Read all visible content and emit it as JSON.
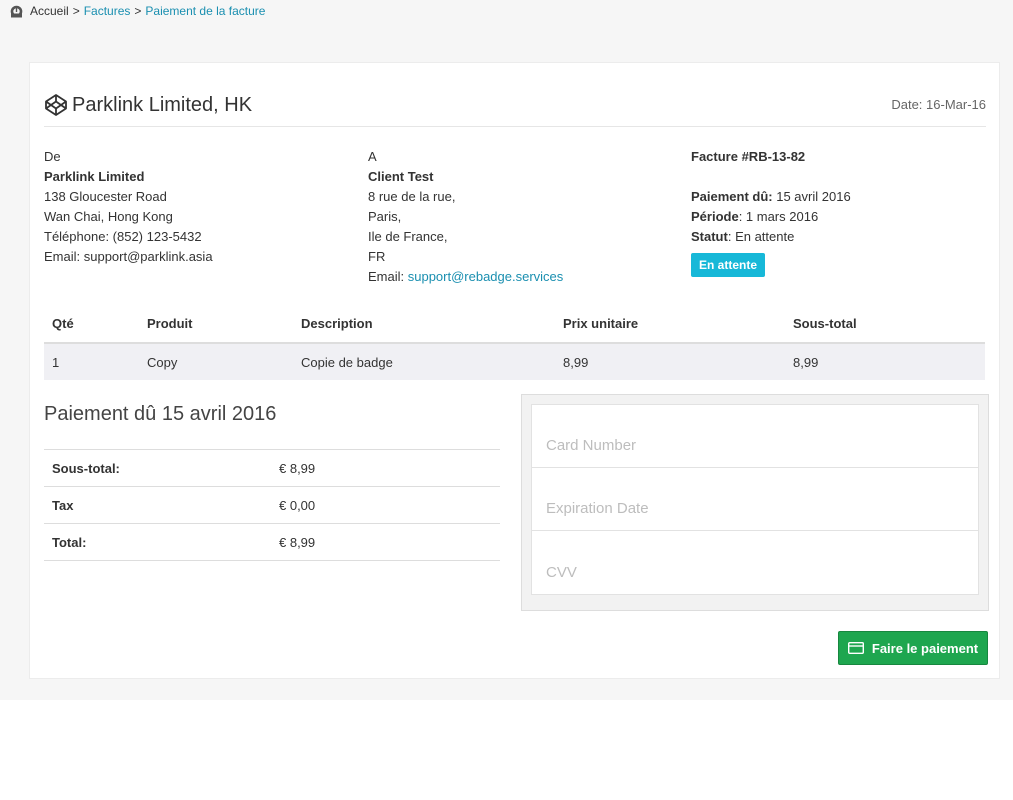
{
  "breadcrumb": {
    "home": "Accueil",
    "sep1": ">",
    "invoices": "Factures",
    "sep2": ">",
    "current": "Paiement de la facture"
  },
  "header": {
    "company_title": "Parklink Limited, HK",
    "date": "Date: 16-Mar-16"
  },
  "from": {
    "label": "De",
    "name": "Parklink Limited",
    "street": "138 Gloucester Road",
    "city": "Wan Chai, Hong Kong",
    "phone": "Téléphone: (852) 123-5432",
    "email": "Email: support@parklink.asia"
  },
  "to": {
    "label": "A",
    "name": "Client Test",
    "street": "8 rue de la rue,",
    "city": "Paris,",
    "region": "Ile de France,",
    "country": "FR",
    "email_label": "Email: ",
    "email": "support@rebadge.services"
  },
  "invoice": {
    "number": "Facture #RB-13-82",
    "due_label": "Paiement dû:",
    "due_value": " 15 avril 2016",
    "period_label": "Période",
    "period_value": ": 1 mars 2016",
    "status_label": "Statut",
    "status_value": ": En attente",
    "status_badge": "En attente",
    "badge_color": "#17b8d8"
  },
  "items": {
    "columns": [
      "Qté",
      "Produit",
      "Description",
      "Prix unitaire",
      "Sous-total"
    ],
    "rows": [
      [
        "1",
        "Copy",
        "Copie de badge",
        "8,99",
        "8,99"
      ]
    ]
  },
  "payment": {
    "title": "Paiement dû 15 avril 2016",
    "totals": [
      {
        "label": "Sous-total:",
        "value": "€ 8,99"
      },
      {
        "label": "Tax",
        "value": "€ 0,00"
      },
      {
        "label": "Total:",
        "value": "€ 8,99"
      }
    ]
  },
  "card_form": {
    "card_number_placeholder": "Card Number",
    "expiration_placeholder": "Expiration Date",
    "cvv_placeholder": "CVV"
  },
  "pay_button": {
    "label": "Faire le paiement",
    "color": "#1ea64f"
  }
}
